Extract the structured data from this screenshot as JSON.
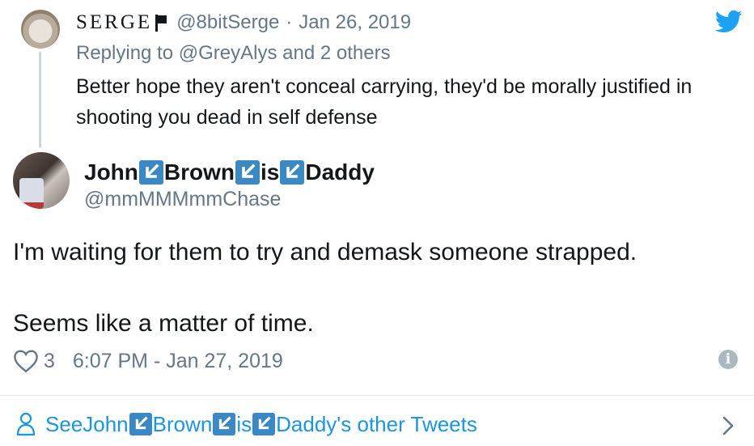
{
  "parent": {
    "name": "SERGE",
    "handle": "@8bitSerge",
    "separator": "·",
    "date": "Jan 26, 2019",
    "replying_prefix": "Replying to ",
    "replying_mention": "@GreyAlys",
    "replying_suffix": " and 2 others",
    "text": "Better hope they aren't conceal carrying, they'd be morally justified in shooting you dead in self defense"
  },
  "main": {
    "name_parts": [
      "John",
      "Brown",
      "is",
      "Daddy"
    ],
    "handle": "@mmMMMmmChase",
    "text_line1": "I'm waiting for them to try and demask someone strapped.",
    "text_line2": "Seems like a matter of time.",
    "like_count": "3",
    "timestamp": "6:07 PM - Jan 27, 2019",
    "info_glyph": "i"
  },
  "footer": {
    "prefix": "See ",
    "name_parts": [
      "John",
      "Brown",
      "is",
      "Daddy's other Tweets"
    ],
    "chevron": "›"
  },
  "icons": {
    "brand": "twitter-bird-icon",
    "emoji": "arrow-down-left-emoji",
    "like": "heart-outline-icon",
    "info": "info-icon",
    "person": "person-icon",
    "chevron": "chevron-right-icon"
  },
  "colors": {
    "text": "#14171a",
    "secondary": "#657786",
    "link": "#1b95e0",
    "brand": "#1da1f2",
    "emoji_bg": "#3b88c3",
    "divider": "#e1e8ed"
  }
}
